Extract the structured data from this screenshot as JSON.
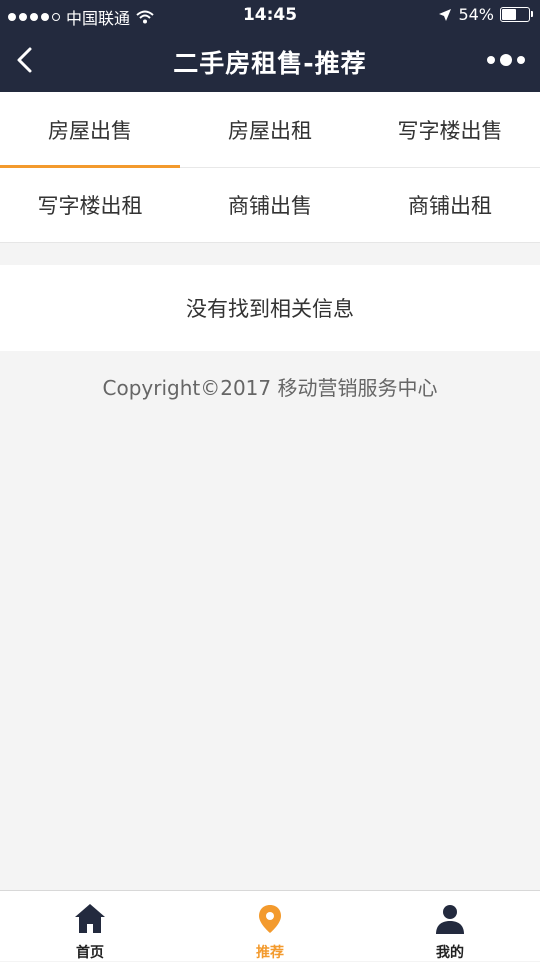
{
  "status_bar": {
    "carrier": "中国联通",
    "time": "14:45",
    "battery_percent": "54%",
    "battery_level": 0.54
  },
  "nav": {
    "title": "二手房租售-推荐"
  },
  "tabs": {
    "row1": [
      "房屋出售",
      "房屋出租",
      "写字楼出售"
    ],
    "row2": [
      "写字楼出租",
      "商铺出售",
      "商铺出租"
    ],
    "active_index": 0
  },
  "content": {
    "empty_message": "没有找到相关信息",
    "copyright": "Copyright©2017 移动营销服务中心"
  },
  "bottom_tabs": [
    {
      "label": "首页",
      "icon": "home-icon"
    },
    {
      "label": "推荐",
      "icon": "recommend-icon"
    },
    {
      "label": "我的",
      "icon": "user-icon"
    }
  ],
  "colors": {
    "header_bg": "#232a3e",
    "accent": "#f39a2d",
    "page_bg": "#f4f4f4"
  }
}
